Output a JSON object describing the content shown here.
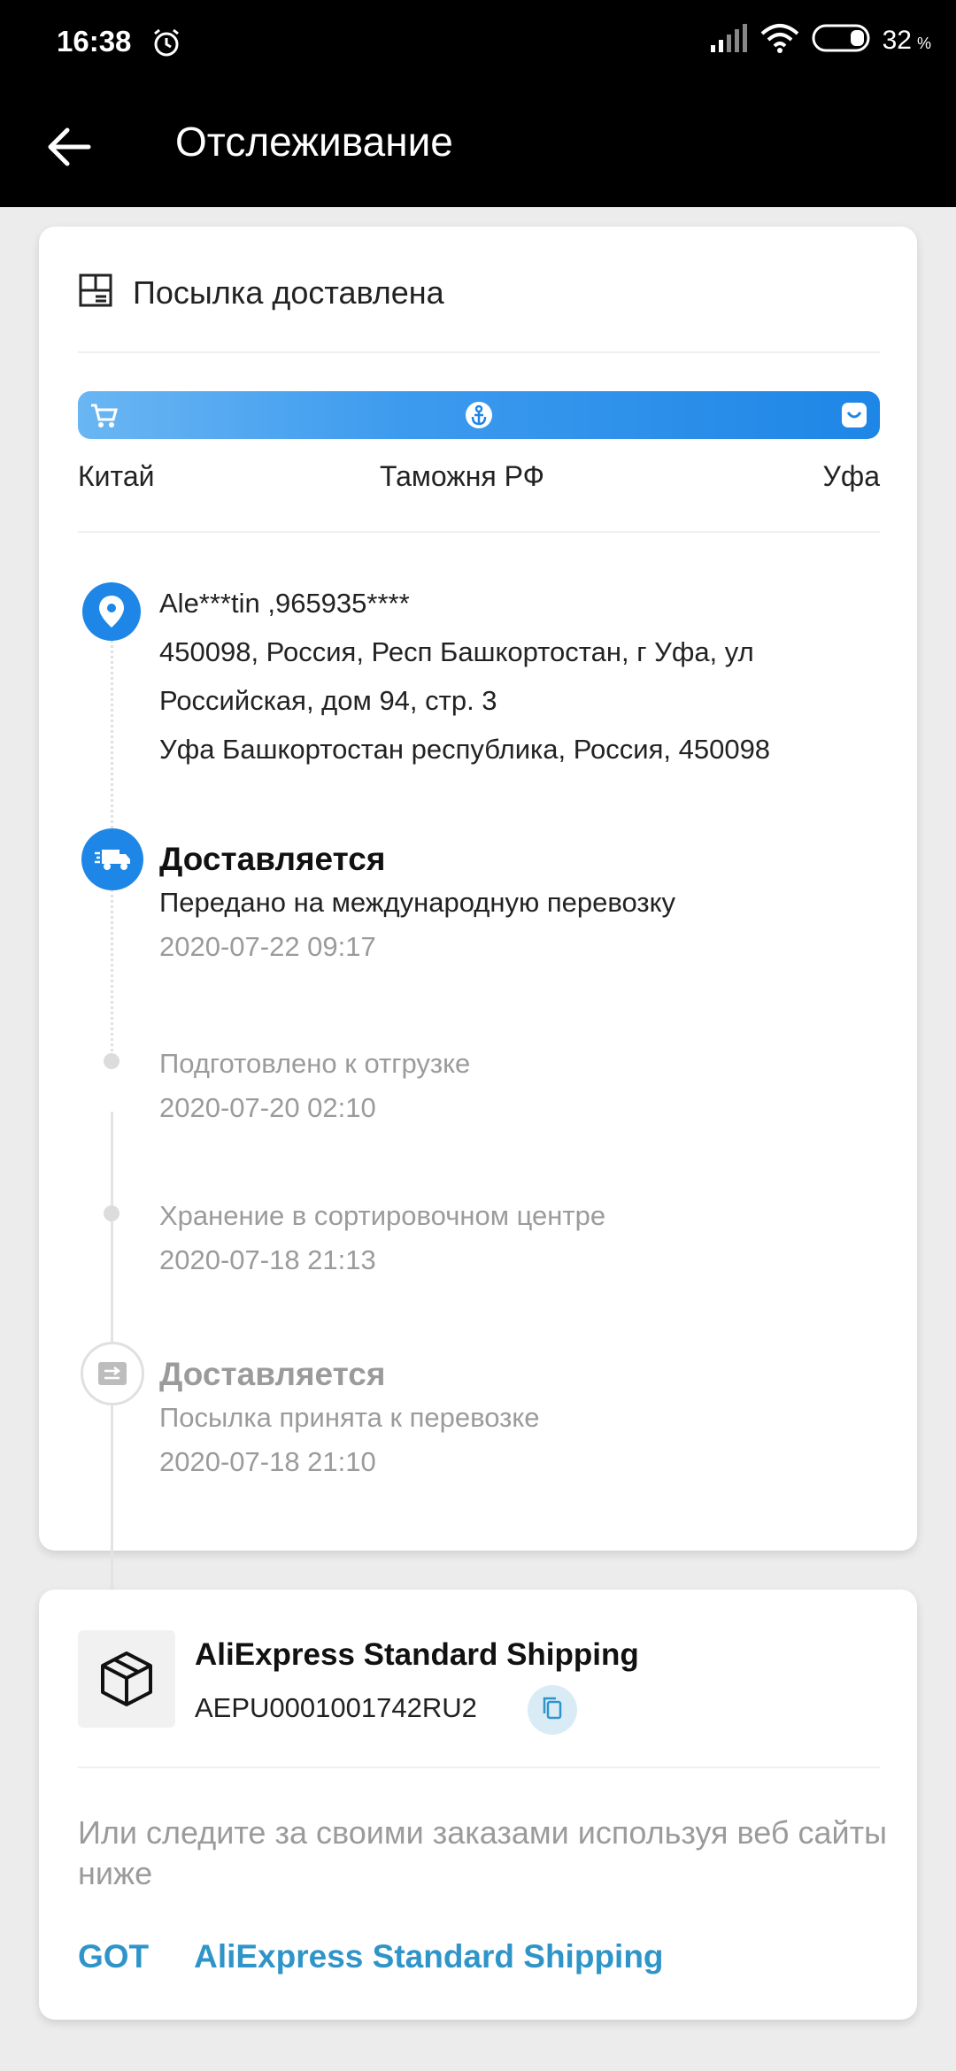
{
  "status_bar": {
    "time": "16:38",
    "battery": "32",
    "battery_unit": "%"
  },
  "app_bar": {
    "title": "Отслеживание"
  },
  "summary": {
    "status": "Посылка доставлена",
    "progress": 1.0,
    "locations": [
      "Китай",
      "Таможня РФ",
      "Уфа"
    ]
  },
  "address": {
    "recipient": "Ale***tin ,965935****",
    "line1": "450098,  Россия, Респ Башкортостан, г Уфа, ул",
    "line2": "Российская, дом 94, стр. 3",
    "line3": "Уфа Башкортостан республика, Россия, 450098"
  },
  "events": [
    {
      "title": "Доставляется",
      "desc": "Передано на международную перевозку",
      "date": "2020-07-22 09:17"
    },
    {
      "title": "",
      "desc": "Подготовлено к отгрузке",
      "date": "2020-07-20 02:10"
    },
    {
      "title": "",
      "desc": "Хранение в сортировочном центре",
      "date": "2020-07-18 21:13"
    },
    {
      "title": "Доставляется",
      "desc": "Посылка принята к перевозке",
      "date": "2020-07-18 21:10"
    }
  ],
  "shipping": {
    "carrier": "AliExpress Standard Shipping",
    "tracking_number": "AEPU0001001742RU2",
    "or_text": "Или следите за своими заказами используя веб сайты ниже",
    "links": [
      "GOT",
      "AliExpress Standard Shipping"
    ]
  },
  "colors": {
    "accent_blue": "#1e86e6",
    "link_blue": "#2f95c9"
  }
}
